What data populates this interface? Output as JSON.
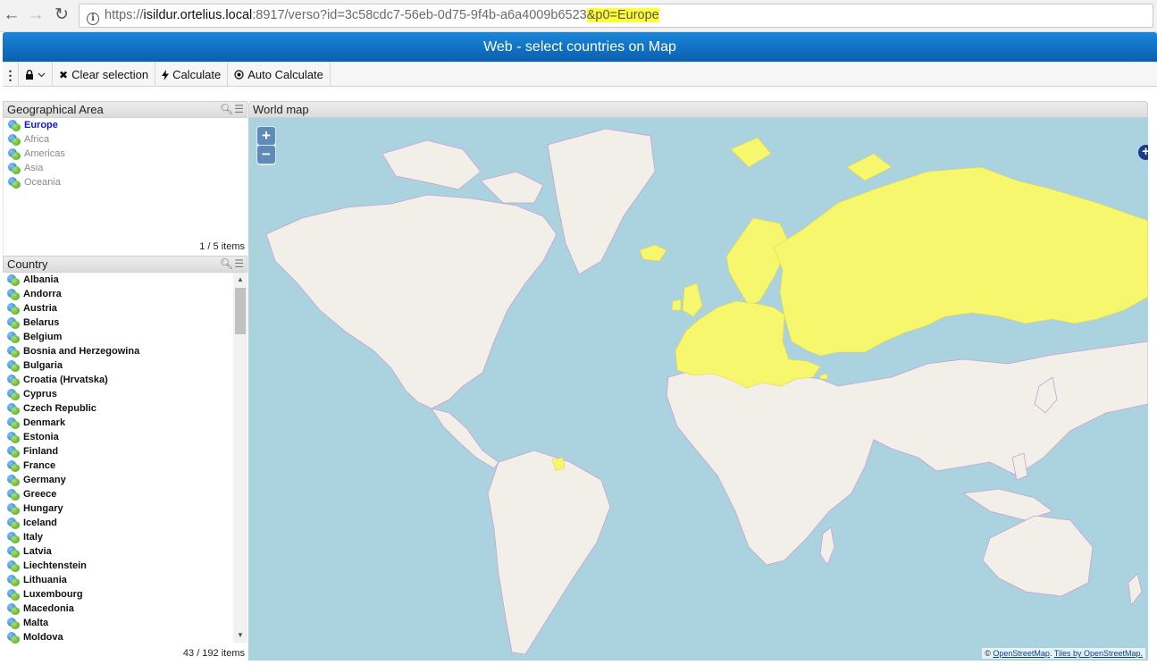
{
  "browser": {
    "url_protocol": "https://",
    "url_host": "isildur.ortelius.local",
    "url_path": ":8917/verso?id=3c58cdc7-56eb-0d75-9f4b-a6a4009b6523",
    "url_highlight": "&p0=Europe"
  },
  "app": {
    "title": "Web - select countries on Map"
  },
  "toolbar": {
    "clear_label": "Clear selection",
    "calculate_label": "Calculate",
    "auto_calculate_label": "Auto Calculate"
  },
  "geo_panel": {
    "title": "Geographical Area",
    "items": [
      {
        "label": "Europe",
        "selected": true
      },
      {
        "label": "Africa",
        "selected": false
      },
      {
        "label": "Americas",
        "selected": false
      },
      {
        "label": "Asia",
        "selected": false
      },
      {
        "label": "Oceania",
        "selected": false
      }
    ],
    "count": "1 / 5 items"
  },
  "country_panel": {
    "title": "Country",
    "items": [
      "Albania",
      "Andorra",
      "Austria",
      "Belarus",
      "Belgium",
      "Bosnia and Herzegowina",
      "Bulgaria",
      "Croatia (Hrvatska)",
      "Cyprus",
      "Czech Republic",
      "Denmark",
      "Estonia",
      "Finland",
      "France",
      "Germany",
      "Greece",
      "Hungary",
      "Iceland",
      "Italy",
      "Latvia",
      "Liechtenstein",
      "Lithuania",
      "Luxembourg",
      "Macedonia",
      "Malta",
      "Moldova"
    ],
    "count": "43 / 192 items"
  },
  "map": {
    "title": "World map",
    "zoom_in": "+",
    "zoom_out": "−",
    "attribution_prefix": "©",
    "attribution_osm": "OpenStreetMap",
    "attribution_tiles": "Tiles by OpenStreetMap.",
    "colors": {
      "water": "#aad3df",
      "land": "#f2efe9",
      "selected": "#f7f76e",
      "border": "#c9a0d6"
    }
  }
}
